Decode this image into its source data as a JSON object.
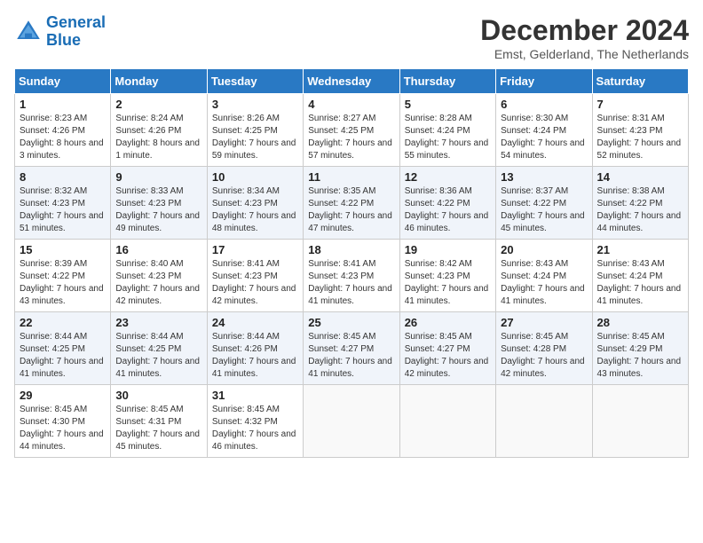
{
  "header": {
    "logo_line1": "General",
    "logo_line2": "Blue",
    "month_title": "December 2024",
    "location": "Emst, Gelderland, The Netherlands"
  },
  "days_of_week": [
    "Sunday",
    "Monday",
    "Tuesday",
    "Wednesday",
    "Thursday",
    "Friday",
    "Saturday"
  ],
  "weeks": [
    [
      {
        "day": "1",
        "sunrise": "8:23 AM",
        "sunset": "4:26 PM",
        "daylight": "8 hours and 3 minutes."
      },
      {
        "day": "2",
        "sunrise": "8:24 AM",
        "sunset": "4:26 PM",
        "daylight": "8 hours and 1 minute."
      },
      {
        "day": "3",
        "sunrise": "8:26 AM",
        "sunset": "4:25 PM",
        "daylight": "7 hours and 59 minutes."
      },
      {
        "day": "4",
        "sunrise": "8:27 AM",
        "sunset": "4:25 PM",
        "daylight": "7 hours and 57 minutes."
      },
      {
        "day": "5",
        "sunrise": "8:28 AM",
        "sunset": "4:24 PM",
        "daylight": "7 hours and 55 minutes."
      },
      {
        "day": "6",
        "sunrise": "8:30 AM",
        "sunset": "4:24 PM",
        "daylight": "7 hours and 54 minutes."
      },
      {
        "day": "7",
        "sunrise": "8:31 AM",
        "sunset": "4:23 PM",
        "daylight": "7 hours and 52 minutes."
      }
    ],
    [
      {
        "day": "8",
        "sunrise": "8:32 AM",
        "sunset": "4:23 PM",
        "daylight": "7 hours and 51 minutes."
      },
      {
        "day": "9",
        "sunrise": "8:33 AM",
        "sunset": "4:23 PM",
        "daylight": "7 hours and 49 minutes."
      },
      {
        "day": "10",
        "sunrise": "8:34 AM",
        "sunset": "4:23 PM",
        "daylight": "7 hours and 48 minutes."
      },
      {
        "day": "11",
        "sunrise": "8:35 AM",
        "sunset": "4:22 PM",
        "daylight": "7 hours and 47 minutes."
      },
      {
        "day": "12",
        "sunrise": "8:36 AM",
        "sunset": "4:22 PM",
        "daylight": "7 hours and 46 minutes."
      },
      {
        "day": "13",
        "sunrise": "8:37 AM",
        "sunset": "4:22 PM",
        "daylight": "7 hours and 45 minutes."
      },
      {
        "day": "14",
        "sunrise": "8:38 AM",
        "sunset": "4:22 PM",
        "daylight": "7 hours and 44 minutes."
      }
    ],
    [
      {
        "day": "15",
        "sunrise": "8:39 AM",
        "sunset": "4:22 PM",
        "daylight": "7 hours and 43 minutes."
      },
      {
        "day": "16",
        "sunrise": "8:40 AM",
        "sunset": "4:23 PM",
        "daylight": "7 hours and 42 minutes."
      },
      {
        "day": "17",
        "sunrise": "8:41 AM",
        "sunset": "4:23 PM",
        "daylight": "7 hours and 42 minutes."
      },
      {
        "day": "18",
        "sunrise": "8:41 AM",
        "sunset": "4:23 PM",
        "daylight": "7 hours and 41 minutes."
      },
      {
        "day": "19",
        "sunrise": "8:42 AM",
        "sunset": "4:23 PM",
        "daylight": "7 hours and 41 minutes."
      },
      {
        "day": "20",
        "sunrise": "8:43 AM",
        "sunset": "4:24 PM",
        "daylight": "7 hours and 41 minutes."
      },
      {
        "day": "21",
        "sunrise": "8:43 AM",
        "sunset": "4:24 PM",
        "daylight": "7 hours and 41 minutes."
      }
    ],
    [
      {
        "day": "22",
        "sunrise": "8:44 AM",
        "sunset": "4:25 PM",
        "daylight": "7 hours and 41 minutes."
      },
      {
        "day": "23",
        "sunrise": "8:44 AM",
        "sunset": "4:25 PM",
        "daylight": "7 hours and 41 minutes."
      },
      {
        "day": "24",
        "sunrise": "8:44 AM",
        "sunset": "4:26 PM",
        "daylight": "7 hours and 41 minutes."
      },
      {
        "day": "25",
        "sunrise": "8:45 AM",
        "sunset": "4:27 PM",
        "daylight": "7 hours and 41 minutes."
      },
      {
        "day": "26",
        "sunrise": "8:45 AM",
        "sunset": "4:27 PM",
        "daylight": "7 hours and 42 minutes."
      },
      {
        "day": "27",
        "sunrise": "8:45 AM",
        "sunset": "4:28 PM",
        "daylight": "7 hours and 42 minutes."
      },
      {
        "day": "28",
        "sunrise": "8:45 AM",
        "sunset": "4:29 PM",
        "daylight": "7 hours and 43 minutes."
      }
    ],
    [
      {
        "day": "29",
        "sunrise": "8:45 AM",
        "sunset": "4:30 PM",
        "daylight": "7 hours and 44 minutes."
      },
      {
        "day": "30",
        "sunrise": "8:45 AM",
        "sunset": "4:31 PM",
        "daylight": "7 hours and 45 minutes."
      },
      {
        "day": "31",
        "sunrise": "8:45 AM",
        "sunset": "4:32 PM",
        "daylight": "7 hours and 46 minutes."
      },
      null,
      null,
      null,
      null
    ]
  ]
}
